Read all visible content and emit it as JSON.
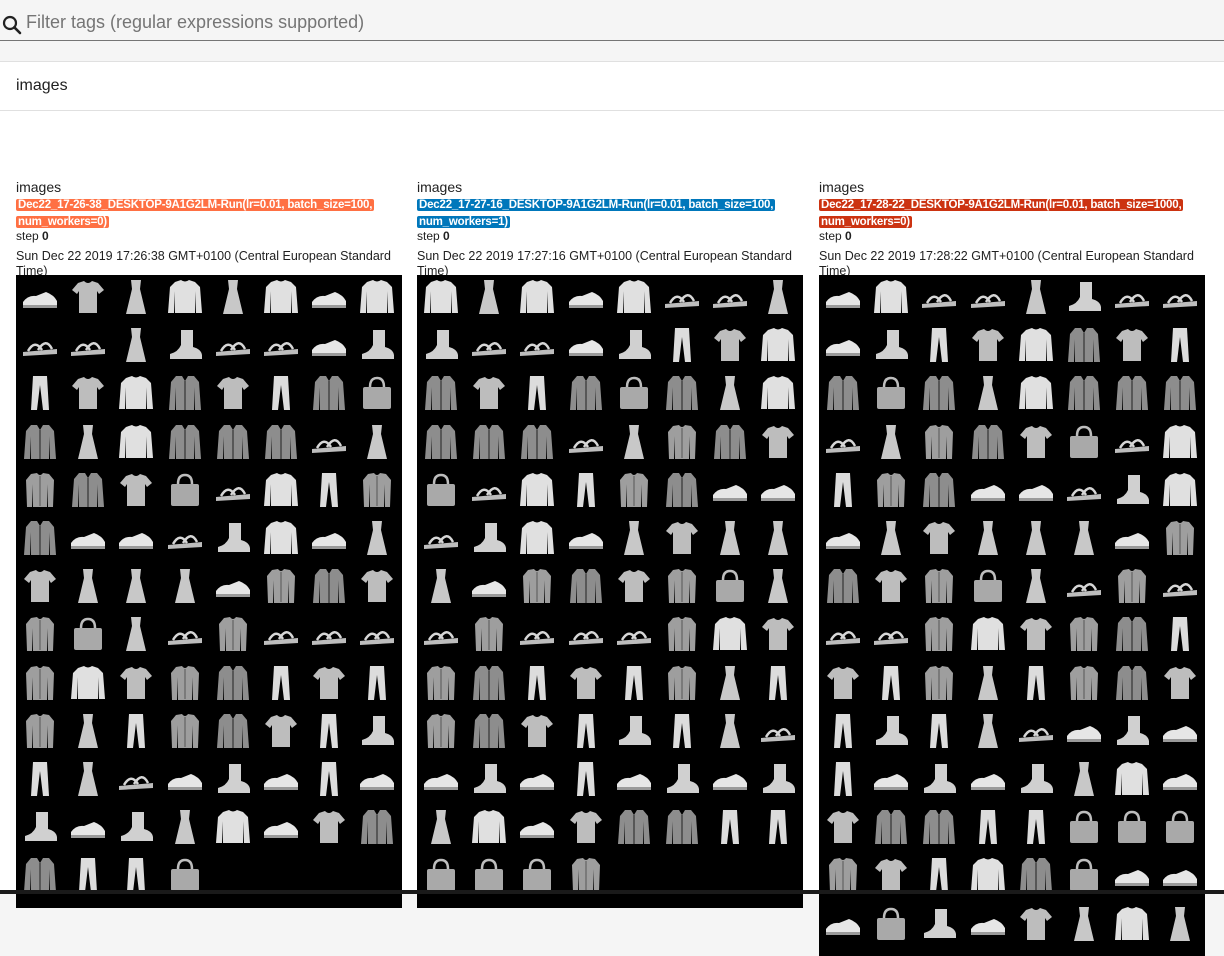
{
  "filter": {
    "placeholder": "Filter tags (regular expressions supported)",
    "value": ""
  },
  "category": {
    "title": "images"
  },
  "cards": [
    {
      "tag": "images",
      "run": "Dec22_17-26-38_DESKTOP-9A1G2LM-Run(lr=0.01, batch_size=100, num_workers=0)",
      "run_color": "#ff7043",
      "step_label": "step",
      "step_value": "0",
      "timestamp": "Sun Dec 22 2019 17:26:38 GMT+0100 (Central European Standard Time)",
      "image_rows": 13,
      "thumbnails_in_last_row": 4
    },
    {
      "tag": "images",
      "run": "Dec22_17-27-16_DESKTOP-9A1G2LM-Run(lr=0.01, batch_size=100, num_workers=1)",
      "run_color": "#0077bb",
      "step_label": "step",
      "step_value": "0",
      "timestamp": "Sun Dec 22 2019 17:27:16 GMT+0100 (Central European Standard Time)",
      "image_rows": 13,
      "thumbnails_in_last_row": 4
    },
    {
      "tag": "images",
      "run": "Dec22_17-28-22_DESKTOP-9A1G2LM-Run(lr=0.01, batch_size=1000, num_workers=0)",
      "run_color": "#cc3311",
      "step_label": "step",
      "step_value": "0",
      "timestamp": "Sun Dec 22 2019 17:28:22 GMT+0100 (Central European Standard Time)",
      "image_rows": 14,
      "thumbnails_in_last_row": 8
    }
  ],
  "thumbnail_kinds": [
    "sneaker",
    "tshirt",
    "dress",
    "pullover",
    "dress",
    "pullover",
    "sneaker",
    "pullover",
    "sandal",
    "sandal",
    "dress",
    "ankle-boot",
    "sandal",
    "sandal",
    "sneaker",
    "ankle-boot",
    "trouser",
    "tshirt",
    "pullover",
    "coat",
    "tshirt",
    "trouser",
    "coat",
    "bag",
    "coat",
    "dress",
    "pullover",
    "coat",
    "coat",
    "coat",
    "sandal",
    "dress",
    "shirt",
    "coat",
    "tshirt",
    "bag",
    "sandal",
    "pullover",
    "trouser",
    "shirt",
    "coat",
    "sneaker",
    "sneaker",
    "sandal",
    "ankle-boot",
    "pullover",
    "sneaker",
    "dress",
    "tshirt",
    "dress",
    "dress",
    "dress",
    "sneaker",
    "shirt",
    "coat",
    "tshirt",
    "shirt",
    "bag",
    "dress",
    "sandal",
    "shirt",
    "sandal",
    "sandal",
    "sandal",
    "shirt",
    "pullover",
    "tshirt",
    "shirt",
    "coat",
    "trouser",
    "tshirt",
    "trouser",
    "shirt",
    "dress",
    "trouser",
    "shirt",
    "coat",
    "tshirt",
    "trouser",
    "ankle-boot",
    "trouser",
    "dress",
    "sandal",
    "sneaker",
    "ankle-boot",
    "sneaker",
    "trouser",
    "sneaker",
    "ankle-boot",
    "sneaker",
    "ankle-boot",
    "dress",
    "pullover",
    "sneaker",
    "tshirt",
    "coat",
    "coat",
    "trouser",
    "trouser",
    "bag",
    "bag",
    "bag",
    "shirt",
    "tshirt",
    "trouser",
    "pullover",
    "coat",
    "bag",
    "sneaker",
    "sneaker",
    "sneaker",
    "bag",
    "ankle-boot"
  ]
}
